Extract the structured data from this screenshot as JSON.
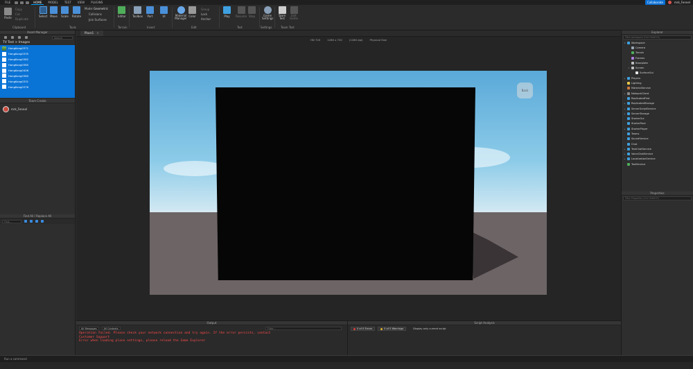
{
  "menubar": {
    "items": [
      "FILE",
      "HOME",
      "MODEL",
      "TEST",
      "VIEW",
      "PLUGINS"
    ],
    "active": "HOME",
    "collaborate": "Collaborate",
    "user": "mrk_Fennel"
  },
  "ribbon": {
    "clipboard": {
      "paste": "Paste",
      "copy": "Copy",
      "cut": "Cut",
      "duplicate": "Duplicate",
      "group": "Clipboard"
    },
    "tools": {
      "select": "Select",
      "move": "Move",
      "scale": "Scale",
      "rotate": "Rotate",
      "mode": "Mode:",
      "mode_value": "Geometric",
      "collisions": "Collisions",
      "join": "Join Surfaces",
      "group": "Tools"
    },
    "terrain": {
      "editor": "Editor",
      "group": "Terrain"
    },
    "insert": {
      "toolbox": "Toolbox",
      "part": "Part",
      "ui": "UI",
      "group": "Insert"
    },
    "edit": {
      "material": "Material Manager",
      "color": "Color",
      "group_btn": "Group",
      "lock": "Lock",
      "anchor": "Anchor",
      "group": "Edit"
    },
    "test": {
      "play": "Play",
      "resume": "Resume",
      "stop": "Stop",
      "group": "Test"
    },
    "settings": {
      "game": "Game Settings",
      "group": "Settings"
    },
    "team_test": {
      "team": "Team Test",
      "exit": "Exit Game",
      "group": "Team Test"
    }
  },
  "asset_manager": {
    "title": "Asset Manager",
    "search_placeholder": "Search",
    "crumb": "TV Test  >  Images",
    "items": [
      "HongKong0371",
      "HongKong0335",
      "HongKong0382",
      "HongKong0365",
      "HongKong0406",
      "HongKong0380",
      "HongKong0331",
      "HongKong0376"
    ]
  },
  "team_create": {
    "title": "Team Create",
    "user": "mrk_Fennel"
  },
  "find_all": {
    "title": "Find All / Replace All",
    "placeholder": "Find..."
  },
  "viewport": {
    "tab": "Place1",
    "resolution": "HD 720",
    "size": "1280 x 720",
    "dpi": "(1280 dpi)",
    "orientation": "Physical Size",
    "back_button": "Back"
  },
  "explorer": {
    "title": "Explorer",
    "filter": "Filter workspace (Ctrl+Shift+X)",
    "rows": [
      {
        "label": "Workspace",
        "depth": 0,
        "arrow": "v",
        "color": "#3fa0e0"
      },
      {
        "label": "Camera",
        "depth": 1,
        "arrow": "",
        "color": "#9aa7b5"
      },
      {
        "label": "Terrain",
        "depth": 1,
        "arrow": "",
        "color": "#4fae5a"
      },
      {
        "label": "Frames",
        "depth": 1,
        "arrow": "",
        "color": "#b07be0"
      },
      {
        "label": "Baseplate",
        "depth": 1,
        "arrow": "",
        "color": "#bdbdbd"
      },
      {
        "label": "Screen",
        "depth": 1,
        "arrow": "v",
        "color": "#bdbdbd"
      },
      {
        "label": "SurfaceGui",
        "depth": 2,
        "arrow": "",
        "color": "#e8e8e8"
      },
      {
        "label": "Players",
        "depth": 0,
        "arrow": ">",
        "color": "#3fa0e0"
      },
      {
        "label": "Lighting",
        "depth": 0,
        "arrow": "",
        "color": "#e8c94a"
      },
      {
        "label": "MaterialService",
        "depth": 0,
        "arrow": "",
        "color": "#d07a3a"
      },
      {
        "label": "NetworkClient",
        "depth": 0,
        "arrow": ">",
        "color": "#8a8a8a"
      },
      {
        "label": "ReplicatedFirst",
        "depth": 0,
        "arrow": "",
        "color": "#3fa0e0"
      },
      {
        "label": "ReplicatedStorage",
        "depth": 0,
        "arrow": ">",
        "color": "#3fa0e0"
      },
      {
        "label": "ServerScriptService",
        "depth": 0,
        "arrow": ">",
        "color": "#3fa0e0"
      },
      {
        "label": "ServerStorage",
        "depth": 0,
        "arrow": ">",
        "color": "#3fa0e0"
      },
      {
        "label": "StarterGui",
        "depth": 0,
        "arrow": "",
        "color": "#3fa0e0"
      },
      {
        "label": "StarterPack",
        "depth": 0,
        "arrow": "",
        "color": "#3fa0e0"
      },
      {
        "label": "StarterPlayer",
        "depth": 0,
        "arrow": ">",
        "color": "#3fa0e0"
      },
      {
        "label": "Teams",
        "depth": 0,
        "arrow": "",
        "color": "#3fa0e0"
      },
      {
        "label": "SoundService",
        "depth": 0,
        "arrow": "",
        "color": "#3fa0e0"
      },
      {
        "label": "Chat",
        "depth": 0,
        "arrow": "",
        "color": "#3fa0e0"
      },
      {
        "label": "TextChatService",
        "depth": 0,
        "arrow": ">",
        "color": "#3fa0e0"
      },
      {
        "label": "VoiceChatService",
        "depth": 0,
        "arrow": ">",
        "color": "#3fa0e0"
      },
      {
        "label": "LocalizationService",
        "depth": 0,
        "arrow": ">",
        "color": "#3fa0e0"
      },
      {
        "label": "TestService",
        "depth": 0,
        "arrow": "",
        "color": "#4fae5a"
      }
    ]
  },
  "properties": {
    "title": "Properties",
    "filter": "Filter Properties (Ctrl+Shift+P)"
  },
  "output": {
    "title": "Output",
    "messages_filter": "All Messages",
    "contexts_filter": "All Contexts",
    "filter_placeholder": "Filter...",
    "lines": [
      "  Operation failed. Please check your network connection and try again. If the error persists, contact",
      "Customer Support",
      "  Error when loading place settings, please reload the Game Explorer"
    ]
  },
  "script_analysis": {
    "title": "Script Analysis",
    "errors": "0 of 0 Errors",
    "warnings": "0 of 0 Warnings",
    "display": "Display only current script"
  },
  "command_bar": {
    "placeholder": "Run a command"
  }
}
